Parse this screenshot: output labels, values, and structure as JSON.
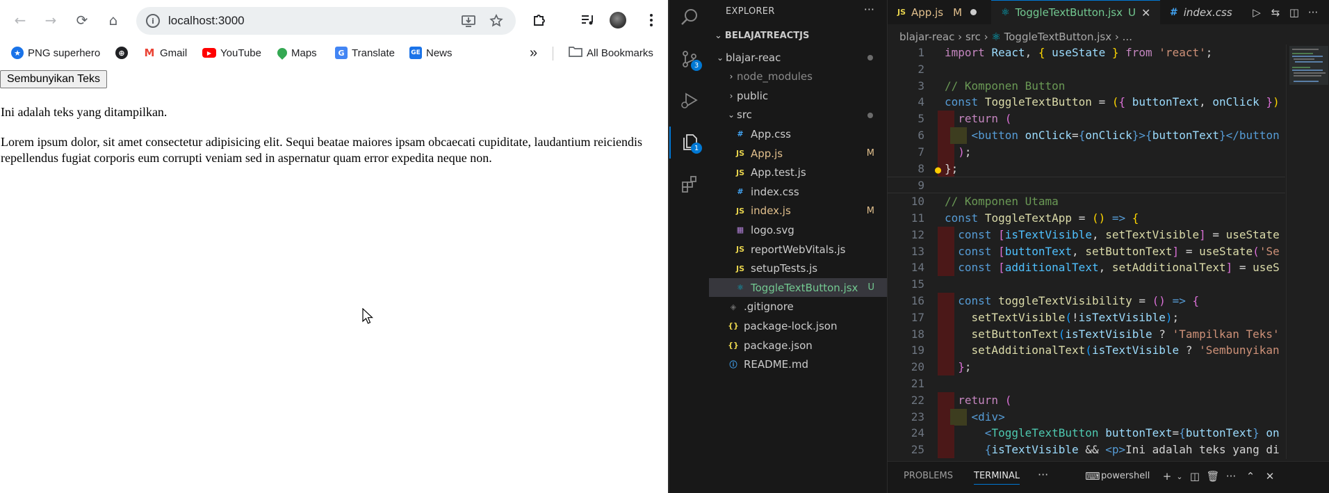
{
  "browser": {
    "nav": {
      "back": "←",
      "forward": "→",
      "reload": "⟳",
      "home": "⌂"
    },
    "omnibox": {
      "url": "localhost:3000"
    },
    "bookmarks": [
      {
        "label": "PNG superhero",
        "icon": "star-icon",
        "color": "#1a73e8"
      },
      {
        "label": "",
        "icon": "globe-icon",
        "color": "#202124"
      },
      {
        "label": "Gmail",
        "icon": "gmail-icon",
        "color": "#ea4335"
      },
      {
        "label": "YouTube",
        "icon": "youtube-icon",
        "color": "#ff0000"
      },
      {
        "label": "Maps",
        "icon": "maps-icon",
        "color": "#34a853"
      },
      {
        "label": "Translate",
        "icon": "translate-icon",
        "color": "#4285f4"
      },
      {
        "label": "News",
        "icon": "news-icon",
        "color": "#1a73e8"
      }
    ],
    "bookmarks_more": "»",
    "all_bookmarks": "All Bookmarks",
    "page": {
      "button_label": "Sembunyikan Teks",
      "visible_text": "Ini adalah teks yang ditampilkan.",
      "additional_text": "Lorem ipsum dolor, sit amet consectetur adipisicing elit. Sequi beatae maiores ipsam obcaecati cupiditate, laudantium reiciendis repellendus fugiat corporis eum corrupti veniam sed in aspernatur quam error expedita neque non."
    }
  },
  "vscode": {
    "activity": {
      "scm_badge": "3",
      "explorer_badge": "1"
    },
    "explorer": {
      "title": "EXPLORER",
      "more": "···",
      "workspace": "BELAJATREACTJS",
      "tree": [
        {
          "name": "blajar-reac",
          "type": "folder-open",
          "color": "#cccccc",
          "decor": "dot"
        },
        {
          "name": "node_modules",
          "type": "folder",
          "color": "#8b8b8b",
          "decor": ""
        },
        {
          "name": "public",
          "type": "folder",
          "color": "#cccccc",
          "decor": ""
        },
        {
          "name": "src",
          "type": "folder-open",
          "color": "#cccccc",
          "decor": "dot"
        },
        {
          "name": "App.css",
          "type": "css",
          "color": "#cccccc",
          "decor": ""
        },
        {
          "name": "App.js",
          "type": "js",
          "color": "#e2c08d",
          "decor": "M"
        },
        {
          "name": "App.test.js",
          "type": "js",
          "color": "#cccccc",
          "decor": ""
        },
        {
          "name": "index.css",
          "type": "css",
          "color": "#cccccc",
          "decor": ""
        },
        {
          "name": "index.js",
          "type": "js",
          "color": "#e2c08d",
          "decor": "M"
        },
        {
          "name": "logo.svg",
          "type": "svg",
          "color": "#cccccc",
          "decor": ""
        },
        {
          "name": "reportWebVitals.js",
          "type": "js",
          "color": "#cccccc",
          "decor": ""
        },
        {
          "name": "setupTests.js",
          "type": "js",
          "color": "#cccccc",
          "decor": ""
        },
        {
          "name": "ToggleTextButton.jsx",
          "type": "jsx",
          "color": "#73c991",
          "decor": "U"
        },
        {
          "name": ".gitignore",
          "type": "git",
          "color": "#cccccc",
          "decor": ""
        },
        {
          "name": "package-lock.json",
          "type": "json",
          "color": "#cccccc",
          "decor": ""
        },
        {
          "name": "package.json",
          "type": "json",
          "color": "#cccccc",
          "decor": ""
        },
        {
          "name": "README.md",
          "type": "info",
          "color": "#cccccc",
          "decor": ""
        }
      ]
    },
    "tabs": [
      {
        "label": "App.js",
        "status": "M",
        "icon": "JS",
        "color": "#e2c08d"
      },
      {
        "label": "ToggleTextButton.jsx",
        "status": "U",
        "icon": "⚛",
        "color": "#73c991"
      },
      {
        "label": "index.css",
        "status": "",
        "icon": "#",
        "color": "#cccccc"
      }
    ],
    "breadcrumb": [
      "blajar-reac",
      "src",
      "ToggleTextButton.jsx",
      "..."
    ],
    "code_lines": [
      {
        "n": "1",
        "html": "<span class='kw2'>import</span> <span class='vr'>React</span><span class='pl'>, </span><span class='br'>{</span><span class='vr'> useState </span><span class='br'>}</span> <span class='kw2'>from</span> <span class='str'>'react'</span><span class='pl'>;</span>"
      },
      {
        "n": "2",
        "html": ""
      },
      {
        "n": "3",
        "html": "<span class='cm'>// Komponen Button</span>"
      },
      {
        "n": "4",
        "html": "<span class='kw'>const</span> <span class='fn'>ToggleTextButton</span> <span class='pl'>=</span> <span class='br'>(</span><span class='br2'>{</span> <span class='vr'>buttonText</span><span class='pl'>, </span><span class='vr'>onClick</span> <span class='br2'>}</span><span class='br'>)</span>"
      },
      {
        "n": "5",
        "html": "  <span class='kw2'>return</span> <span class='br2'>(</span>"
      },
      {
        "n": "6",
        "html": "    <span class='tgb'>&lt;</span><span class='kw'>button</span> <span class='vr'>onClick</span><span class='pl'>=</span><span class='kw'>{</span><span class='vr'>onClick</span><span class='kw'>}</span><span class='tgb'>&gt;</span><span class='kw'>{</span><span class='vr'>buttonText</span><span class='kw'>}</span><span class='tgb'>&lt;/</span><span class='kw'>button</span>"
      },
      {
        "n": "7",
        "html": "  <span class='br2'>)</span><span class='pl'>;</span>"
      },
      {
        "n": "8",
        "html": "<span class='pl'>};</span>"
      },
      {
        "n": "9",
        "html": ""
      },
      {
        "n": "10",
        "html": "<span class='cm'>// Komponen Utama</span>"
      },
      {
        "n": "11",
        "html": "<span class='kw'>const</span> <span class='fn'>ToggleTextApp</span> <span class='pl'>=</span> <span class='br'>()</span> <span class='kw'>=&gt;</span> <span class='br'>{</span>"
      },
      {
        "n": "12",
        "html": "  <span class='kw'>const</span> <span class='br2'>[</span><span class='ct'>isTextVisible</span><span class='pl'>, </span><span class='fn'>setTextVisible</span><span class='br2'>]</span> <span class='pl'>=</span> <span class='fn'>useState</span>"
      },
      {
        "n": "13",
        "html": "  <span class='kw'>const</span> <span class='br2'>[</span><span class='ct'>buttonText</span><span class='pl'>, </span><span class='fn'>setButtonText</span><span class='br2'>]</span> <span class='pl'>=</span> <span class='fn'>useState</span><span class='br2'>(</span><span class='str'>'Se</span>"
      },
      {
        "n": "14",
        "html": "  <span class='kw'>const</span> <span class='br2'>[</span><span class='ct'>additionalText</span><span class='pl'>, </span><span class='fn'>setAdditionalText</span><span class='br2'>]</span> <span class='pl'>=</span> <span class='fn'>useS</span>"
      },
      {
        "n": "15",
        "html": ""
      },
      {
        "n": "16",
        "html": "  <span class='kw'>const</span> <span class='fn'>toggleTextVisibility</span> <span class='pl'>=</span> <span class='br2'>()</span> <span class='kw'>=&gt;</span> <span class='br2'>{</span>"
      },
      {
        "n": "17",
        "html": "    <span class='fn'>setTextVisible</span><span class='br3'>(</span><span class='pl'>!</span><span class='vr'>isTextVisible</span><span class='br3'>)</span><span class='pl'>;</span>"
      },
      {
        "n": "18",
        "html": "    <span class='fn'>setButtonText</span><span class='br3'>(</span><span class='vr'>isTextVisible</span> <span class='pl'>?</span> <span class='str'>'Tampilkan Teks'</span>"
      },
      {
        "n": "19",
        "html": "    <span class='fn'>setAdditionalText</span><span class='br3'>(</span><span class='vr'>isTextVisible</span> <span class='pl'>?</span> <span class='str'>'Sembunyikan</span>"
      },
      {
        "n": "20",
        "html": "  <span class='br2'>}</span><span class='pl'>;</span>"
      },
      {
        "n": "21",
        "html": ""
      },
      {
        "n": "22",
        "html": "  <span class='kw2'>return</span> <span class='br2'>(</span>"
      },
      {
        "n": "23",
        "html": "    <span class='tgb'>&lt;</span><span class='kw'>div</span><span class='tgb'>&gt;</span>"
      },
      {
        "n": "24",
        "html": "      <span class='tgb'>&lt;</span><span class='tg'>ToggleTextButton</span> <span class='vr'>buttonText</span><span class='pl'>=</span><span class='kw'>{</span><span class='vr'>buttonText</span><span class='kw'>}</span> <span class='vr'>on</span>"
      },
      {
        "n": "25",
        "html": "      <span class='kw'>{</span><span class='vr'>isTextVisible</span> <span class='pl'>&amp;&amp;</span> <span class='tgb'>&lt;</span><span class='kw'>p</span><span class='tgb'>&gt;</span><span class='pl'>Ini adalah teks yang di</span>"
      }
    ],
    "panel": {
      "problems": "PROBLEMS",
      "terminal": "TERMINAL",
      "more": "···",
      "shell": "powershell"
    }
  }
}
